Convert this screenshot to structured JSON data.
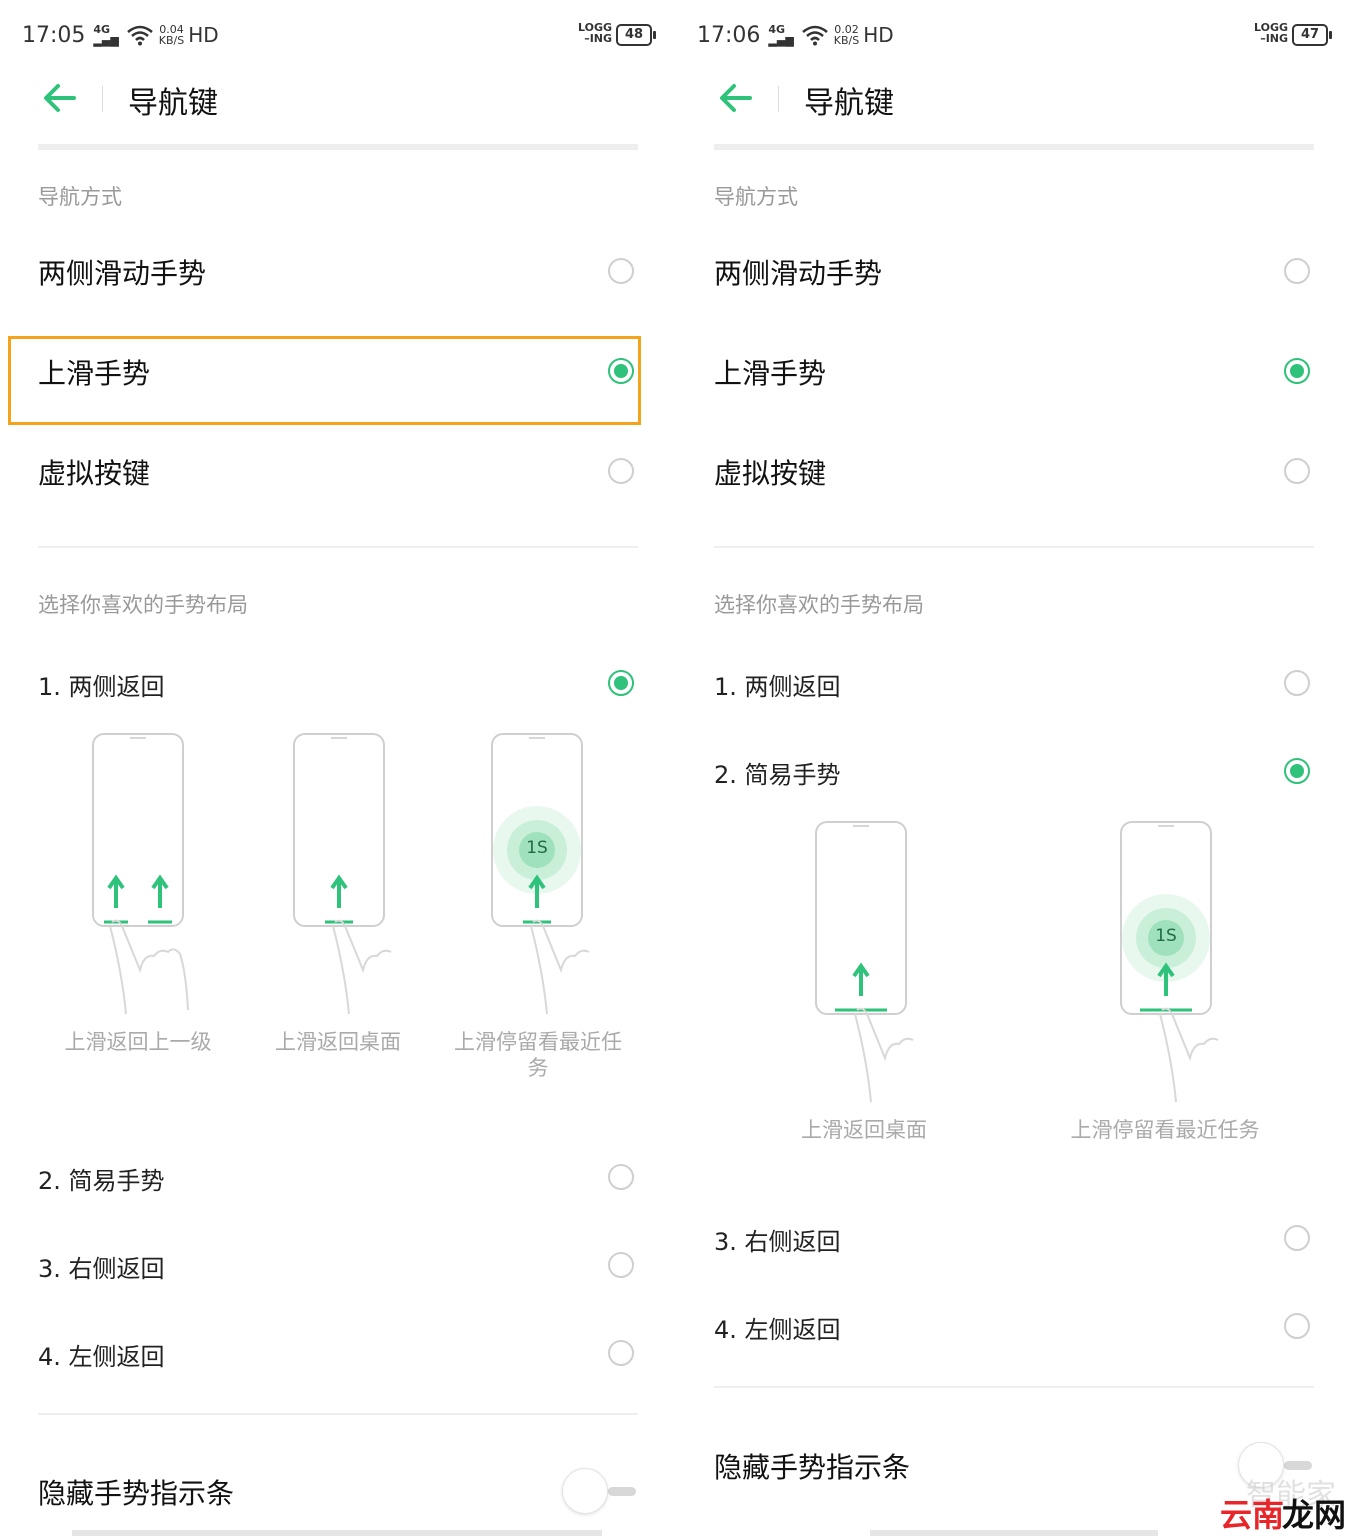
{
  "left": {
    "status": {
      "time": "17:05",
      "network": "4G",
      "speed_value": "0.04",
      "speed_unit": "KB/S",
      "hd": "HD",
      "logging_top": "LOGG",
      "logging_bottom": "ING",
      "battery": "48"
    },
    "title": "导航键",
    "nav_section": "导航方式",
    "nav_options": [
      {
        "label": "两侧滑动手势",
        "selected": false
      },
      {
        "label": "上滑手势",
        "selected": true
      },
      {
        "label": "虚拟按键",
        "selected": false
      }
    ],
    "layout_section": "选择你喜欢的手势布局",
    "layouts": [
      {
        "label": "1. 两侧返回",
        "selected": true
      },
      {
        "label": "2. 简易手势",
        "selected": false
      },
      {
        "label": "3. 右侧返回",
        "selected": false
      },
      {
        "label": "4. 左侧返回",
        "selected": false
      }
    ],
    "illustrations": [
      {
        "caption": "上滑返回上一级"
      },
      {
        "caption": "上滑返回桌面"
      },
      {
        "caption": "上滑停留看最近任务",
        "badge": "1S"
      }
    ],
    "hide_bar": {
      "label": "隐藏手势指示条",
      "on": false
    }
  },
  "right": {
    "status": {
      "time": "17:06",
      "network": "4G",
      "speed_value": "0.02",
      "speed_unit": "KB/S",
      "hd": "HD",
      "logging_top": "LOGG",
      "logging_bottom": "ING",
      "battery": "47"
    },
    "title": "导航键",
    "nav_section": "导航方式",
    "nav_options": [
      {
        "label": "两侧滑动手势",
        "selected": false
      },
      {
        "label": "上滑手势",
        "selected": true
      },
      {
        "label": "虚拟按键",
        "selected": false
      }
    ],
    "layout_section": "选择你喜欢的手势布局",
    "layouts": [
      {
        "label": "1. 两侧返回",
        "selected": false
      },
      {
        "label": "2. 简易手势",
        "selected": true
      },
      {
        "label": "3. 右侧返回",
        "selected": false
      },
      {
        "label": "4. 左侧返回",
        "selected": false
      }
    ],
    "illustrations": [
      {
        "caption": "上滑返回桌面"
      },
      {
        "caption": "上滑停留看最近任务",
        "badge": "1S"
      }
    ],
    "hide_bar": {
      "label": "隐藏手势指示条",
      "on": false
    }
  },
  "watermark": {
    "brand1": "云南",
    "brand2": "龙网",
    "faint": "智能家"
  },
  "colors": {
    "accent": "#2ec27a",
    "highlight": "#f5a31a",
    "muted": "#999999"
  }
}
